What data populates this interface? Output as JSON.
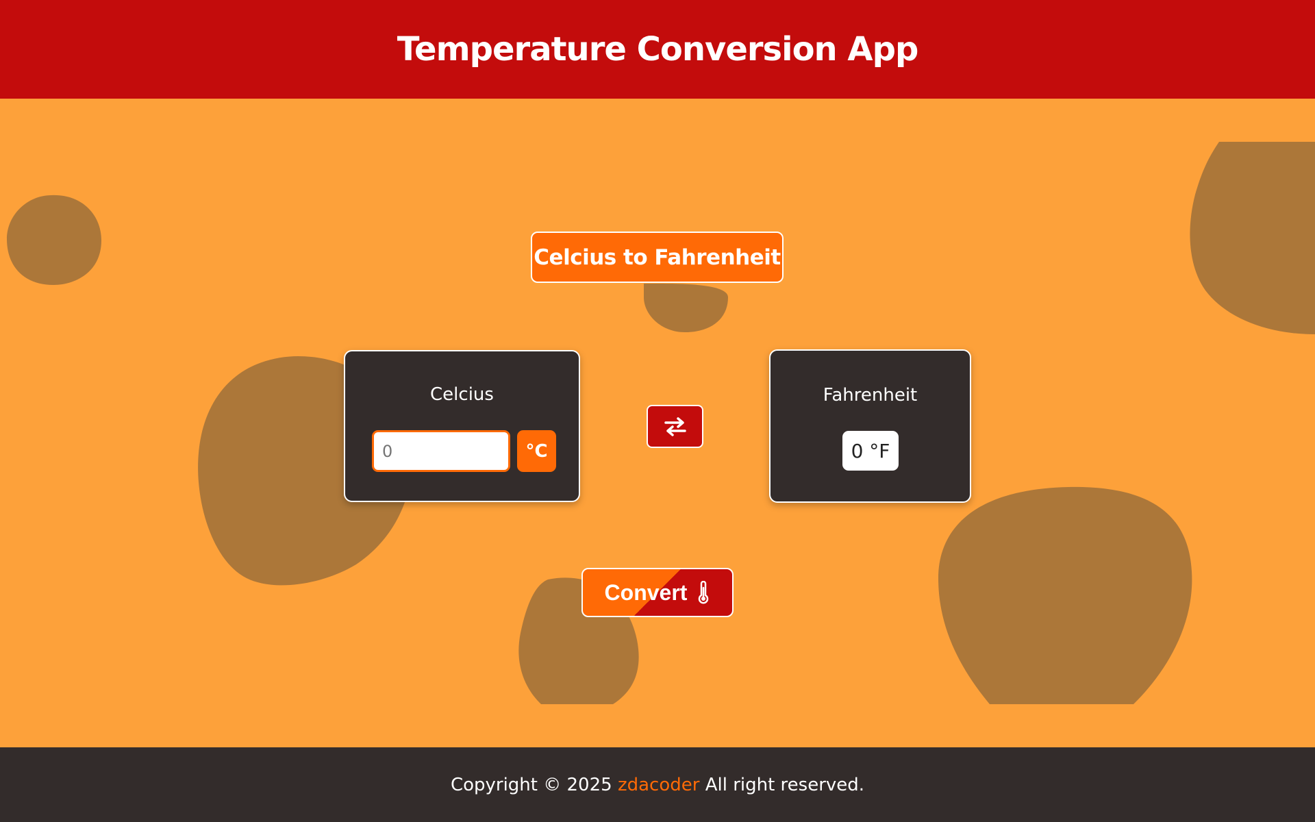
{
  "header": {
    "title": "Temperature Conversion App"
  },
  "mode_button": {
    "label": "Celcius to Fahrenheit"
  },
  "input_card": {
    "label": "Celcius",
    "input_placeholder": "0",
    "unit": "°C"
  },
  "swap_button": {
    "icon": "swap-arrows-icon"
  },
  "output_card": {
    "label": "Fahrenheit",
    "result": "0 °F"
  },
  "convert_button": {
    "label": "Convert",
    "icon": "thermometer-icon"
  },
  "footer": {
    "prefix": "Copyright © 2025",
    "brand": "zdacoder",
    "suffix": "All right reserved."
  },
  "colors": {
    "header_bg": "#c30c0c",
    "page_bg": "#fda13a",
    "blob": "#ac7739",
    "accent_orange": "#ff6a06",
    "accent_red": "#c30c0c",
    "card_bg": "#332c2b",
    "footer_bg": "#332c2b"
  }
}
